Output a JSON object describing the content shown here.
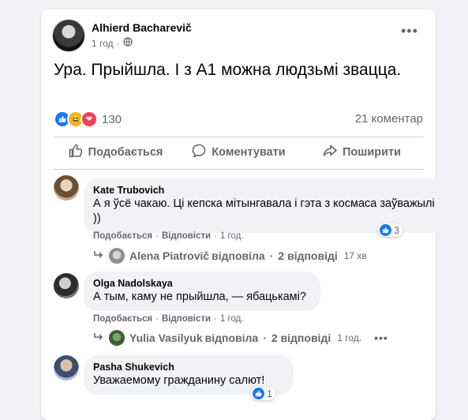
{
  "post": {
    "author": "Alhierd Bacharevič",
    "time": "1 год",
    "separator": "·",
    "text": "Ура. Прыйшла. І з А1 можна людзьмі звацца.",
    "reactions_count": "130",
    "comments_count": "21 коментар"
  },
  "actions": {
    "like": "Подобається",
    "comment": "Коментувати",
    "share": "Поширити"
  },
  "comments": [
    {
      "name": "Kate Trubovich",
      "text": "А я ўсё чакаю. Ці кепска мітынгавала і гэта з космаса заўважылі ))",
      "like": "Подобається",
      "reply": "Відповісти",
      "time": "1 год.",
      "reactions": "3",
      "replies": {
        "name": "Alena Piatrovič",
        "verb": "відповіла",
        "count": "2 відповіді",
        "time": "17 хв"
      }
    },
    {
      "name": "Olga Nadolskaya",
      "text": "А тым, каму не прыйшла, — ябацькамі?",
      "like": "Подобається",
      "reply": "Відповісти",
      "time": "1 год.",
      "replies": {
        "name": "Yulia Vasilyuk",
        "verb": "відповіла",
        "count": "2 відповіді",
        "time": "1 год."
      }
    },
    {
      "name": "Pasha Shukevich",
      "text": "Уважаемому гражданину салют!",
      "reactions": "1"
    }
  ],
  "icons": {
    "globe": "globe-icon",
    "more": "more-icon",
    "like": "thumbs-up-icon",
    "comment": "comment-bubble-icon",
    "share": "share-arrow-icon",
    "reply_arrow": "reply-arrow-icon"
  },
  "colors": {
    "accent": "#1877f2",
    "muted": "#65676b",
    "bubble": "#f0f2f5"
  }
}
